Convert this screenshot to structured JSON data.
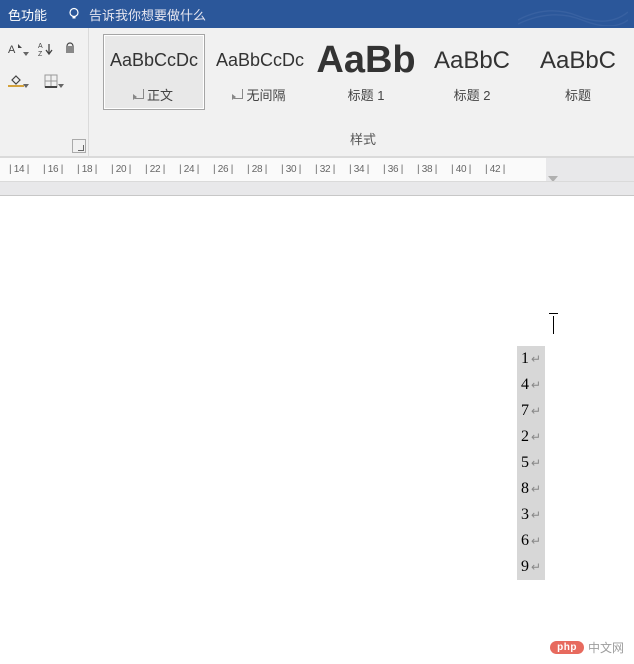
{
  "title_bar": {
    "partial_text": "色功能",
    "tellme_placeholder": "告诉我你想要做什么"
  },
  "ribbon": {
    "sort_label": "A↓Z",
    "styles_group_label": "样式",
    "styles": [
      {
        "preview": "AaBbCcDc",
        "label": "正文",
        "selected": true,
        "previewClass": "preview-normal",
        "hasParaMark": true
      },
      {
        "preview": "AaBbCcDc",
        "label": "无间隔",
        "selected": false,
        "previewClass": "preview-normal",
        "hasParaMark": true
      },
      {
        "preview": "AaBb",
        "label": "标题 1",
        "selected": false,
        "previewClass": "preview-h1",
        "hasParaMark": false
      },
      {
        "preview": "AaBbC",
        "label": "标题 2",
        "selected": false,
        "previewClass": "preview-h2",
        "hasParaMark": false
      },
      {
        "preview": "AaBbC",
        "label": "标题",
        "selected": false,
        "previewClass": "preview-h2",
        "hasParaMark": false
      }
    ]
  },
  "ruler_ticks": [
    "| 14 |",
    "| 16 |",
    "| 18 |",
    "| 20 |",
    "| 22 |",
    "| 24 |",
    "| 26 |",
    "| 28 |",
    "| 30 |",
    "| 32 |",
    "| 34 |",
    "| 36 |",
    "| 38 |",
    "| 40 |",
    "| 42 |"
  ],
  "document_lines": [
    "1",
    "4",
    "7",
    "2",
    "5",
    "8",
    "3",
    "6",
    "9"
  ],
  "watermark": {
    "badge": "php",
    "text": "中文网"
  }
}
